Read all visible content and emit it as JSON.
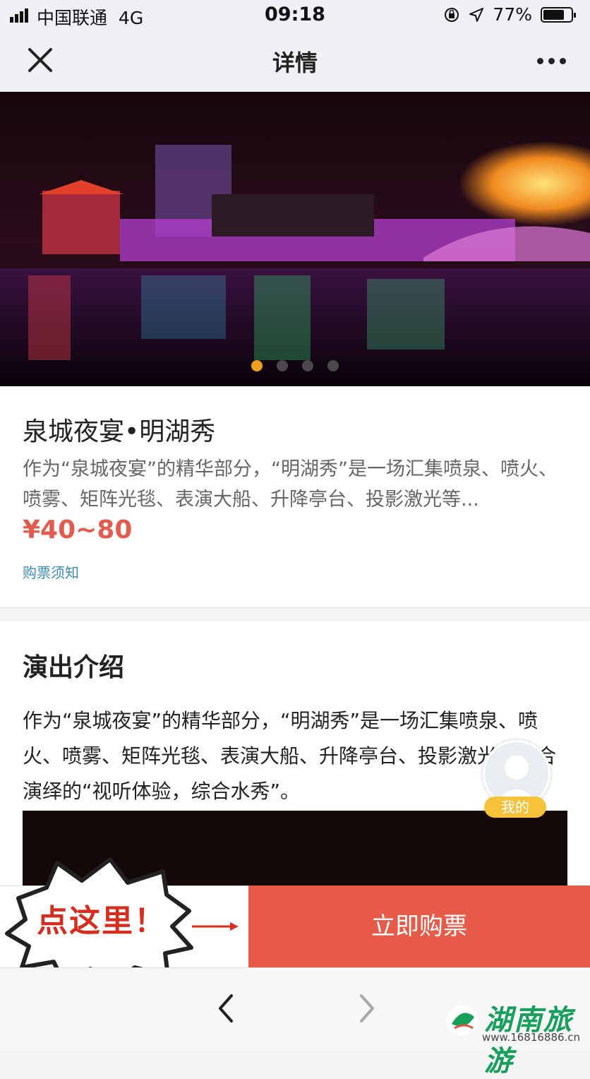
{
  "status_bar": {
    "carrier": "中国联通",
    "network": "4G",
    "time": "09:18",
    "battery_percent": "77%",
    "battery_level": 0.77
  },
  "nav": {
    "title": "详情",
    "close_icon": "close-icon",
    "more_icon": "more-icon"
  },
  "hero": {
    "carousel_pages": 4,
    "active_page": 1
  },
  "show": {
    "title": "泉城夜宴•明湖秀",
    "summary": "作为“泉城夜宴”的精华部分，“明湖秀”是一场汇集喷泉、喷火、喷雾、矩阵光毯、表演大船、升降亭台、投影激光等...",
    "price": "¥40~80",
    "ticket_notice": "购票须知"
  },
  "intro": {
    "heading": "演出介绍",
    "line1": "作为“泉城夜宴”的精华部分，“明湖秀”是一场汇集喷泉、喷",
    "line2": "火、喷雾、矩阵光毯、表演大船、升降亭台、投影激光等综合",
    "line3": "演绎的“视听体验，综合水秀”。"
  },
  "floating": {
    "mine_label": "我的"
  },
  "action": {
    "callout": "点这里！",
    "buy_label": "立即购票",
    "buy_color": "#e85a48"
  },
  "browser": {
    "back_icon": "chevron-left-icon",
    "forward_icon": "chevron-right-icon"
  },
  "watermark": {
    "name": "湖南旅游",
    "url": "www.16816886.cn"
  }
}
